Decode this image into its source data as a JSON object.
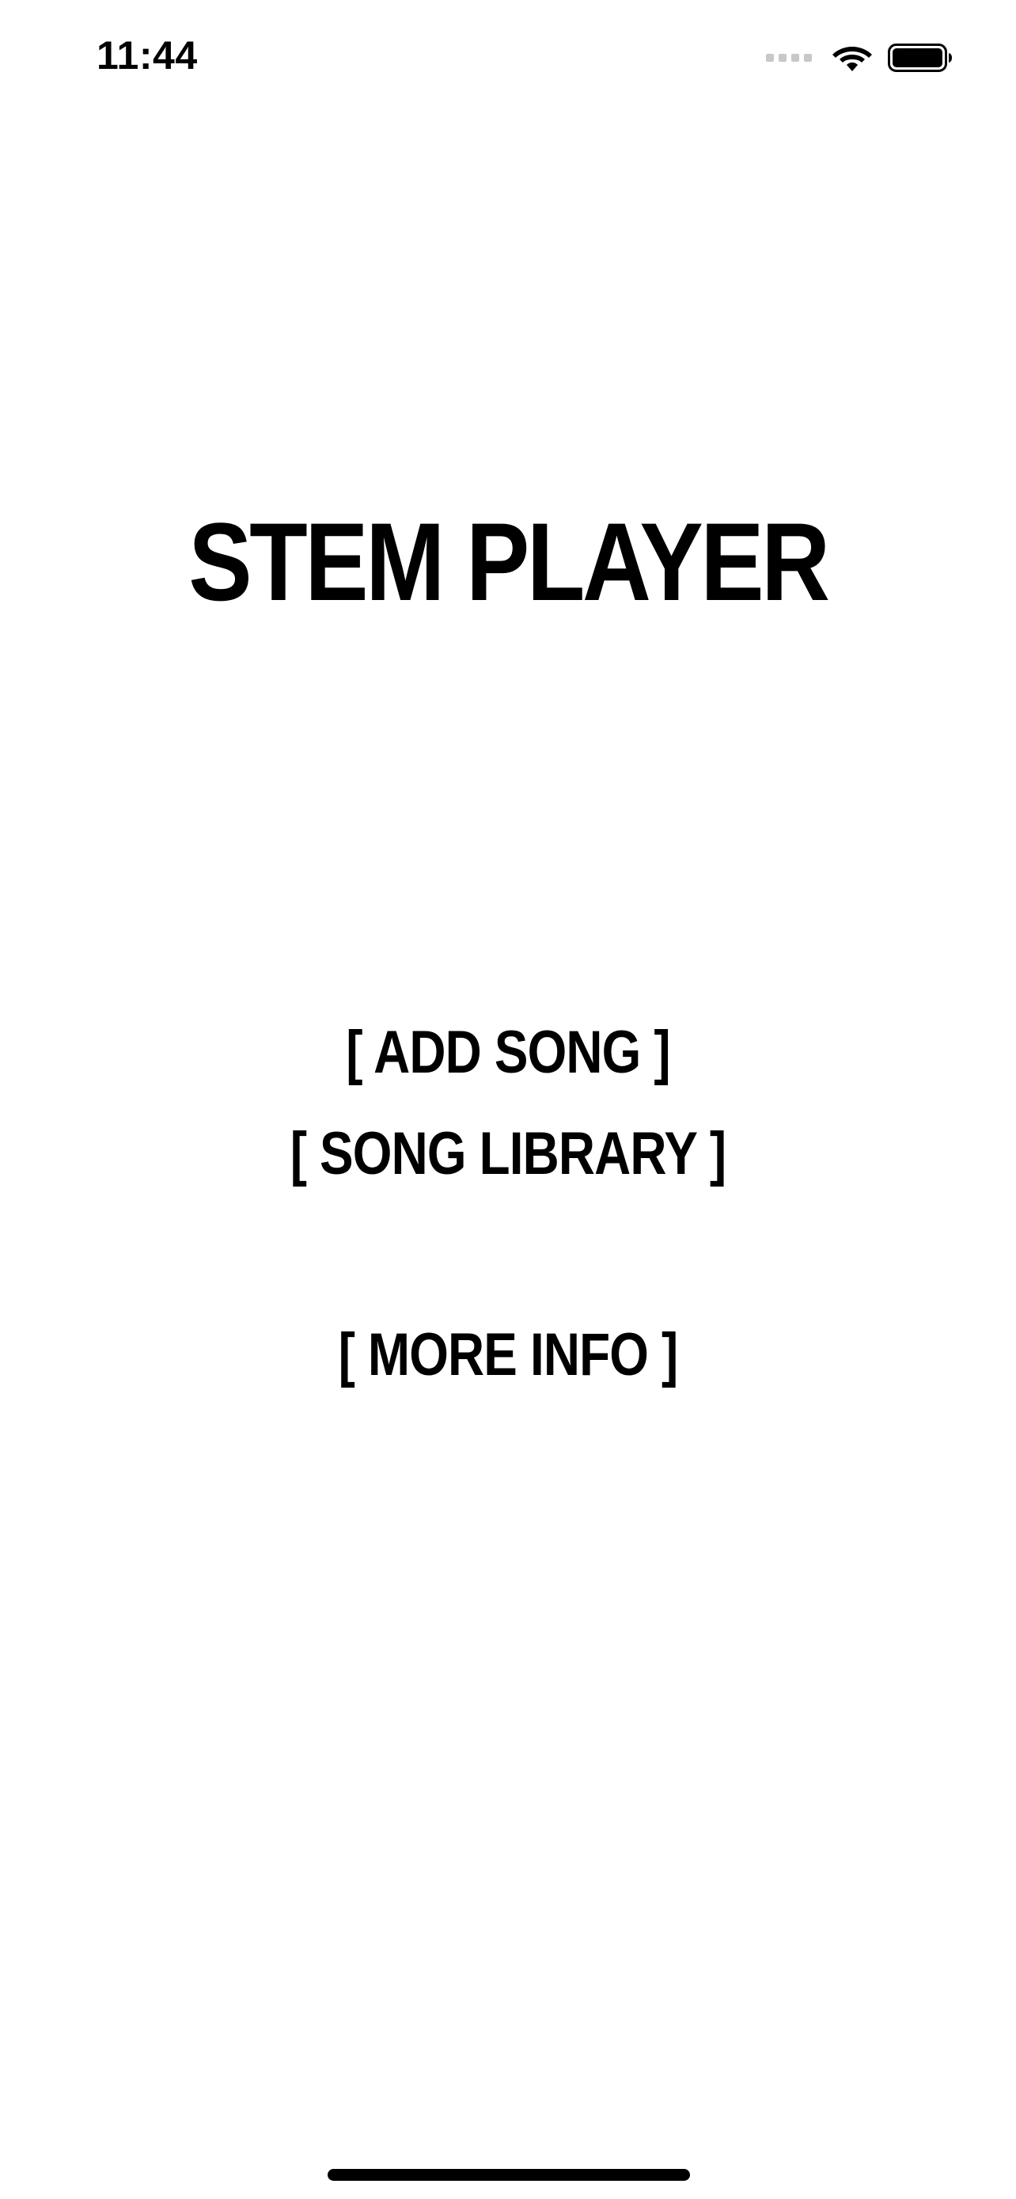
{
  "status_bar": {
    "time": "11:44",
    "icons": [
      "cellular-signal-icon",
      "wifi-icon",
      "battery-icon"
    ]
  },
  "app": {
    "title": "STEM PLAYER"
  },
  "menu": {
    "add_song": "[ ADD SONG ]",
    "song_library": "[ SONG LIBRARY ]",
    "more_info": "[ MORE INFO ]"
  },
  "colors": {
    "background": "#ffffff",
    "text": "#000000",
    "signal_inactive": "#c8c8c8"
  }
}
